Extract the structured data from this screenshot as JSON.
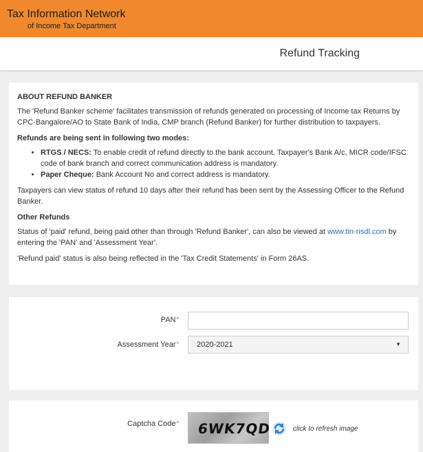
{
  "header": {
    "org_name": "Tax Information Network",
    "org_sub": "of Income Tax Department"
  },
  "page_title": "Refund Tracking",
  "about": {
    "heading": "ABOUT REFUND BANKER",
    "intro": "The 'Refund Banker scheme' facilitates transmission of refunds generated on processing of Income tax Returns by CPC-Bangalore/AO to State Bank of India, CMP branch (Refund Banker) for further distribution to taxpayers.",
    "modes_heading": "Refunds are being sent in following two modes:",
    "modes": [
      {
        "name": "RTGS / NECS:",
        "text": " To enable credit of refund directly to the bank account, Taxpayer's Bank A/c, MICR code/IFSC code of bank branch and correct communication address is mandatory."
      },
      {
        "name": "Paper Cheque:",
        "text": " Bank Account No and correct address is mandatory."
      }
    ],
    "status_note": "Taxpayers can view status of refund 10 days after their refund has been sent by the Assessing Officer to the Refund Banker.",
    "other_heading": "Other Refunds",
    "other_text_1": "Status of 'paid' refund, being paid other than through 'Refund Banker', can also be viewed at ",
    "other_link": "www.tin-nsdl.com",
    "other_text_2": " by entering the 'PAN' and 'Assessment Year'.",
    "tcs_note": "'Refund paid' status is also being reflected in the 'Tax Credit Statements' in Form 26AS."
  },
  "form": {
    "pan_label": "PAN",
    "pan_value": "",
    "ay_label": "Assessment Year",
    "ay_value": "2020-2021",
    "required_mark": "*",
    "captcha_label": "Captcha Code",
    "captcha_text": "6WK7QD",
    "refresh_text": "click to refresh image"
  },
  "colors": {
    "header_bg": "#f0892e",
    "link": "#2a6ebb",
    "required": "#d9534f"
  }
}
